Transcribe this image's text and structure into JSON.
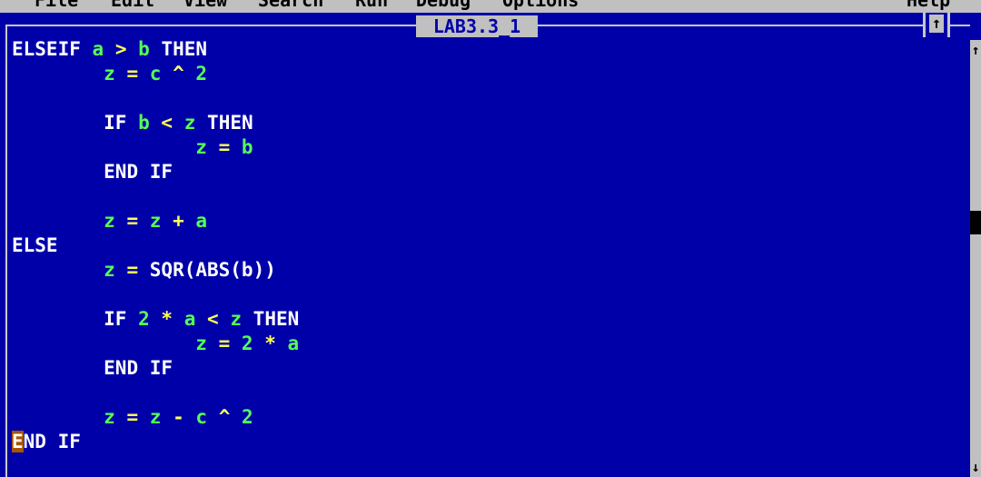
{
  "menubar": {
    "items": [
      "File",
      "Edit",
      "View",
      "Search",
      "Run",
      "Debug",
      "Options",
      "Help"
    ]
  },
  "window": {
    "title": "LAB3.3_1",
    "maximize_glyph": "↑"
  },
  "scrollbar": {
    "up_glyph": "↑",
    "down_glyph": "↓"
  },
  "code_lines": [
    [
      [
        "kw",
        "ELSEIF"
      ],
      [
        "sp",
        " "
      ],
      [
        "id",
        "a"
      ],
      [
        "sp",
        " "
      ],
      [
        "op",
        ">"
      ],
      [
        "sp",
        " "
      ],
      [
        "id",
        "b"
      ],
      [
        "sp",
        " "
      ],
      [
        "kw",
        "THEN"
      ]
    ],
    [
      [
        "sp",
        "        "
      ],
      [
        "id",
        "z"
      ],
      [
        "sp",
        " "
      ],
      [
        "op",
        "="
      ],
      [
        "sp",
        " "
      ],
      [
        "id",
        "c"
      ],
      [
        "sp",
        " "
      ],
      [
        "op",
        "^"
      ],
      [
        "sp",
        " "
      ],
      [
        "num",
        "2"
      ]
    ],
    [],
    [
      [
        "sp",
        "        "
      ],
      [
        "kw",
        "IF"
      ],
      [
        "sp",
        " "
      ],
      [
        "id",
        "b"
      ],
      [
        "sp",
        " "
      ],
      [
        "op",
        "<"
      ],
      [
        "sp",
        " "
      ],
      [
        "id",
        "z"
      ],
      [
        "sp",
        " "
      ],
      [
        "kw",
        "THEN"
      ]
    ],
    [
      [
        "sp",
        "                "
      ],
      [
        "id",
        "z"
      ],
      [
        "sp",
        " "
      ],
      [
        "op",
        "="
      ],
      [
        "sp",
        " "
      ],
      [
        "id",
        "b"
      ]
    ],
    [
      [
        "sp",
        "        "
      ],
      [
        "kw",
        "END IF"
      ]
    ],
    [],
    [
      [
        "sp",
        "        "
      ],
      [
        "id",
        "z"
      ],
      [
        "sp",
        " "
      ],
      [
        "op",
        "="
      ],
      [
        "sp",
        " "
      ],
      [
        "id",
        "z"
      ],
      [
        "sp",
        " "
      ],
      [
        "op",
        "+"
      ],
      [
        "sp",
        " "
      ],
      [
        "id",
        "a"
      ]
    ],
    [
      [
        "kw",
        "ELSE"
      ]
    ],
    [
      [
        "sp",
        "        "
      ],
      [
        "id",
        "z"
      ],
      [
        "sp",
        " "
      ],
      [
        "op",
        "="
      ],
      [
        "sp",
        " "
      ],
      [
        "kw",
        "SQR(ABS(b))"
      ]
    ],
    [],
    [
      [
        "sp",
        "        "
      ],
      [
        "kw",
        "IF"
      ],
      [
        "sp",
        " "
      ],
      [
        "num",
        "2"
      ],
      [
        "sp",
        " "
      ],
      [
        "op",
        "*"
      ],
      [
        "sp",
        " "
      ],
      [
        "id",
        "a"
      ],
      [
        "sp",
        " "
      ],
      [
        "op",
        "<"
      ],
      [
        "sp",
        " "
      ],
      [
        "id",
        "z"
      ],
      [
        "sp",
        " "
      ],
      [
        "kw",
        "THEN"
      ]
    ],
    [
      [
        "sp",
        "                "
      ],
      [
        "id",
        "z"
      ],
      [
        "sp",
        " "
      ],
      [
        "op",
        "="
      ],
      [
        "sp",
        " "
      ],
      [
        "num",
        "2"
      ],
      [
        "sp",
        " "
      ],
      [
        "op",
        "*"
      ],
      [
        "sp",
        " "
      ],
      [
        "id",
        "a"
      ]
    ],
    [
      [
        "sp",
        "        "
      ],
      [
        "kw",
        "END IF"
      ]
    ],
    [],
    [
      [
        "sp",
        "        "
      ],
      [
        "id",
        "z"
      ],
      [
        "sp",
        " "
      ],
      [
        "op",
        "="
      ],
      [
        "sp",
        " "
      ],
      [
        "id",
        "z"
      ],
      [
        "sp",
        " "
      ],
      [
        "op",
        "-"
      ],
      [
        "sp",
        " "
      ],
      [
        "id",
        "c"
      ],
      [
        "sp",
        " "
      ],
      [
        "op",
        "^"
      ],
      [
        "sp",
        " "
      ],
      [
        "num",
        "2"
      ]
    ],
    [
      [
        "cursor",
        "E"
      ],
      [
        "kw",
        "ND IF"
      ]
    ]
  ],
  "colors": {
    "background": "#0000a8",
    "keyword": "#ffffff",
    "identifier": "#55ff55",
    "operator": "#ffff55",
    "cursor": "#a85400",
    "chrome": "#c0c0c0"
  }
}
